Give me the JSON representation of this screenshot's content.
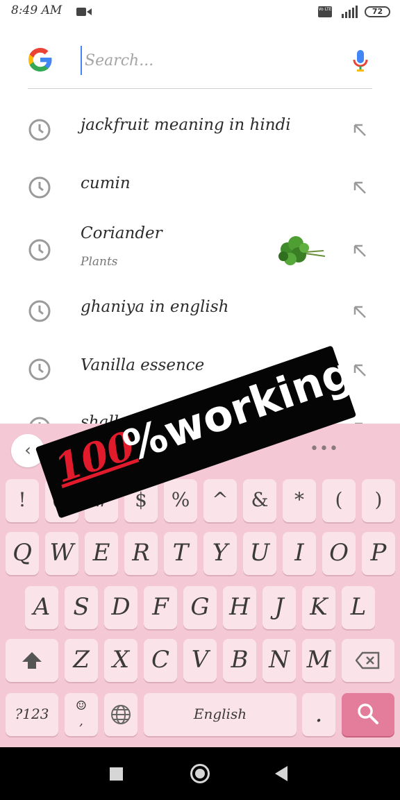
{
  "status_bar": {
    "time": "8:49 AM",
    "volte": "Vo LTE",
    "battery": "72"
  },
  "search": {
    "placeholder": "Search...",
    "value": ""
  },
  "suggestions": [
    {
      "text": "jackfruit meaning in hindi",
      "sub": ""
    },
    {
      "text": "cumin",
      "sub": ""
    },
    {
      "text": "Coriander",
      "sub": "Plants"
    },
    {
      "text": "ghaniya in english",
      "sub": ""
    },
    {
      "text": "Vanilla essence",
      "sub": ""
    },
    {
      "text": "shall",
      "sub": ""
    }
  ],
  "keyboard": {
    "back_label": "‹",
    "more_label": "•••",
    "symbol_row": [
      "!",
      "@",
      "#",
      "$",
      "%",
      "^",
      "&",
      "*",
      "(",
      ")"
    ],
    "row1": [
      "Q",
      "W",
      "E",
      "R",
      "T",
      "Y",
      "U",
      "I",
      "O",
      "P"
    ],
    "row2": [
      "A",
      "S",
      "D",
      "F",
      "G",
      "H",
      "J",
      "K",
      "L"
    ],
    "row3": [
      "Z",
      "X",
      "C",
      "V",
      "B",
      "N",
      "M"
    ],
    "num_label": "?123",
    "emoji_label": "☺",
    "comma_label": ",",
    "space_label": "English",
    "period_label": "."
  },
  "overlay": {
    "hundred": "100",
    "text": "%working"
  },
  "colors": {
    "keyboard_bg": "#f4c9d5",
    "key_bg": "#fbe3ea",
    "search_key_bg": "#e47d9b",
    "sticker_bg": "#050505",
    "sticker_red": "#e11b2c"
  }
}
